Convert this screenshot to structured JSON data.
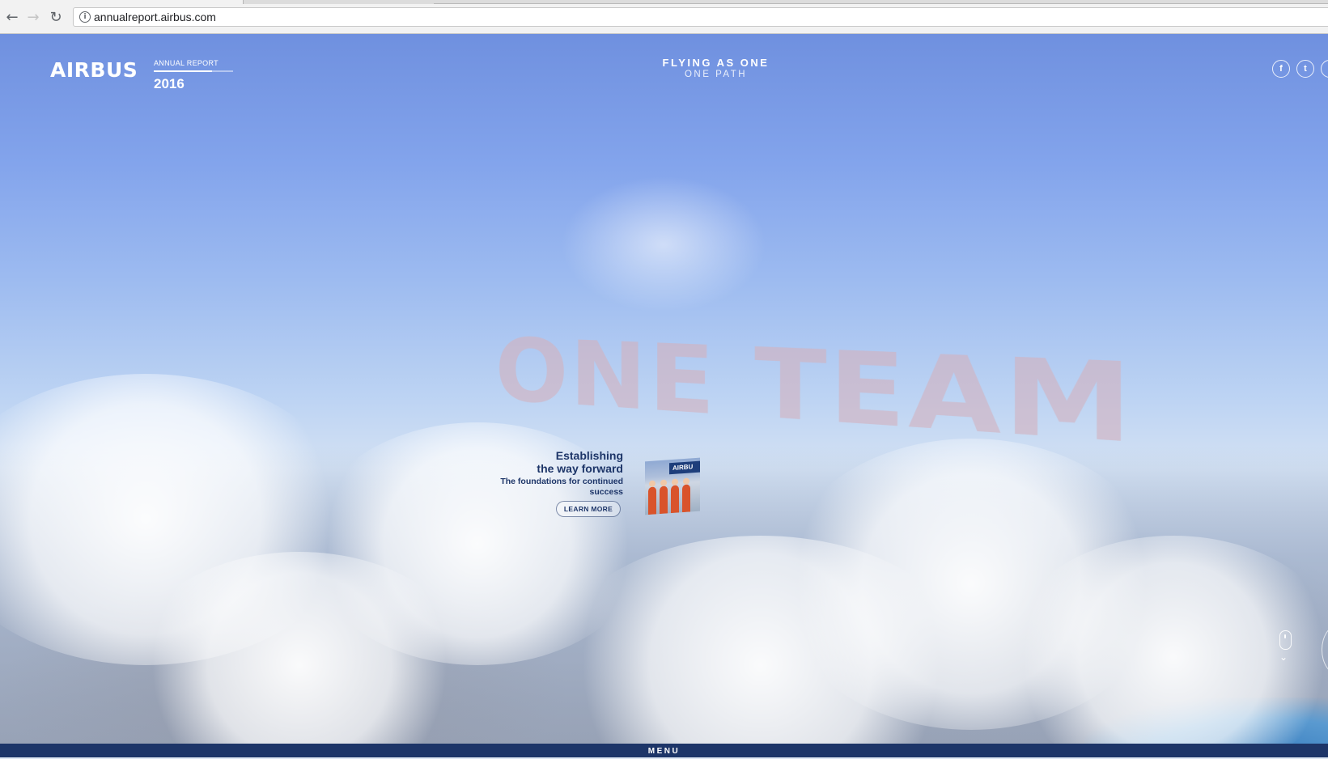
{
  "browser": {
    "url": "annualreport.airbus.com",
    "back_icon": "arrow-left-icon",
    "forward_icon": "arrow-right-icon",
    "reload_icon": "reload-icon",
    "info_icon": "info-icon"
  },
  "header": {
    "brand": "AIRBUS",
    "report_label": "ANNUAL REPORT",
    "report_year": "2016",
    "tagline": "FLYING AS ONE",
    "subtagline": "ONE PATH",
    "social": [
      {
        "name": "facebook",
        "glyph": "f"
      },
      {
        "name": "twitter",
        "glyph": "t"
      },
      {
        "name": "linkedin",
        "glyph": "i"
      }
    ]
  },
  "hero": {
    "title": "ONE TEAM"
  },
  "story": {
    "headline_line1": "Establishing",
    "headline_line2": "the way forward",
    "subtitle": "The foundations for continued success",
    "button": "LEARN MORE",
    "photo_banner": "AIRBU"
  },
  "footer": {
    "menu_label": "MENU"
  },
  "colors": {
    "brand_blue": "#1d3568",
    "sky_top": "#6f90df",
    "hero_title": "#d2b2be"
  }
}
